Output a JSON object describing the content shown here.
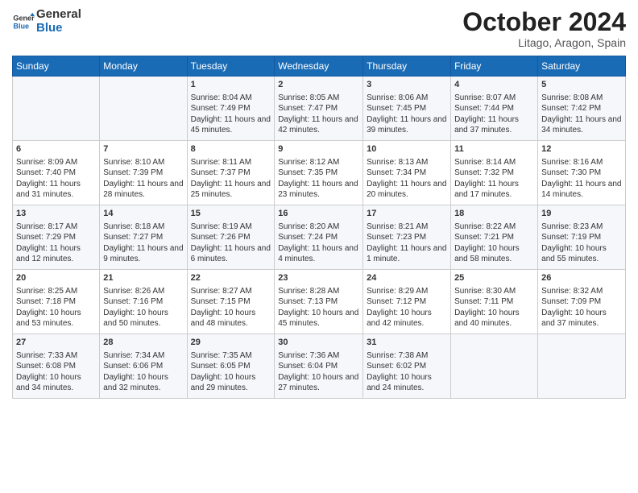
{
  "header": {
    "logo_general": "General",
    "logo_blue": "Blue",
    "month_title": "October 2024",
    "location": "Litago, Aragon, Spain"
  },
  "days_of_week": [
    "Sunday",
    "Monday",
    "Tuesday",
    "Wednesday",
    "Thursday",
    "Friday",
    "Saturday"
  ],
  "weeks": [
    [
      {
        "day": "",
        "info": ""
      },
      {
        "day": "",
        "info": ""
      },
      {
        "day": "1",
        "info": "Sunrise: 8:04 AM\nSunset: 7:49 PM\nDaylight: 11 hours and 45 minutes."
      },
      {
        "day": "2",
        "info": "Sunrise: 8:05 AM\nSunset: 7:47 PM\nDaylight: 11 hours and 42 minutes."
      },
      {
        "day": "3",
        "info": "Sunrise: 8:06 AM\nSunset: 7:45 PM\nDaylight: 11 hours and 39 minutes."
      },
      {
        "day": "4",
        "info": "Sunrise: 8:07 AM\nSunset: 7:44 PM\nDaylight: 11 hours and 37 minutes."
      },
      {
        "day": "5",
        "info": "Sunrise: 8:08 AM\nSunset: 7:42 PM\nDaylight: 11 hours and 34 minutes."
      }
    ],
    [
      {
        "day": "6",
        "info": "Sunrise: 8:09 AM\nSunset: 7:40 PM\nDaylight: 11 hours and 31 minutes."
      },
      {
        "day": "7",
        "info": "Sunrise: 8:10 AM\nSunset: 7:39 PM\nDaylight: 11 hours and 28 minutes."
      },
      {
        "day": "8",
        "info": "Sunrise: 8:11 AM\nSunset: 7:37 PM\nDaylight: 11 hours and 25 minutes."
      },
      {
        "day": "9",
        "info": "Sunrise: 8:12 AM\nSunset: 7:35 PM\nDaylight: 11 hours and 23 minutes."
      },
      {
        "day": "10",
        "info": "Sunrise: 8:13 AM\nSunset: 7:34 PM\nDaylight: 11 hours and 20 minutes."
      },
      {
        "day": "11",
        "info": "Sunrise: 8:14 AM\nSunset: 7:32 PM\nDaylight: 11 hours and 17 minutes."
      },
      {
        "day": "12",
        "info": "Sunrise: 8:16 AM\nSunset: 7:30 PM\nDaylight: 11 hours and 14 minutes."
      }
    ],
    [
      {
        "day": "13",
        "info": "Sunrise: 8:17 AM\nSunset: 7:29 PM\nDaylight: 11 hours and 12 minutes."
      },
      {
        "day": "14",
        "info": "Sunrise: 8:18 AM\nSunset: 7:27 PM\nDaylight: 11 hours and 9 minutes."
      },
      {
        "day": "15",
        "info": "Sunrise: 8:19 AM\nSunset: 7:26 PM\nDaylight: 11 hours and 6 minutes."
      },
      {
        "day": "16",
        "info": "Sunrise: 8:20 AM\nSunset: 7:24 PM\nDaylight: 11 hours and 4 minutes."
      },
      {
        "day": "17",
        "info": "Sunrise: 8:21 AM\nSunset: 7:23 PM\nDaylight: 11 hours and 1 minute."
      },
      {
        "day": "18",
        "info": "Sunrise: 8:22 AM\nSunset: 7:21 PM\nDaylight: 10 hours and 58 minutes."
      },
      {
        "day": "19",
        "info": "Sunrise: 8:23 AM\nSunset: 7:19 PM\nDaylight: 10 hours and 55 minutes."
      }
    ],
    [
      {
        "day": "20",
        "info": "Sunrise: 8:25 AM\nSunset: 7:18 PM\nDaylight: 10 hours and 53 minutes."
      },
      {
        "day": "21",
        "info": "Sunrise: 8:26 AM\nSunset: 7:16 PM\nDaylight: 10 hours and 50 minutes."
      },
      {
        "day": "22",
        "info": "Sunrise: 8:27 AM\nSunset: 7:15 PM\nDaylight: 10 hours and 48 minutes."
      },
      {
        "day": "23",
        "info": "Sunrise: 8:28 AM\nSunset: 7:13 PM\nDaylight: 10 hours and 45 minutes."
      },
      {
        "day": "24",
        "info": "Sunrise: 8:29 AM\nSunset: 7:12 PM\nDaylight: 10 hours and 42 minutes."
      },
      {
        "day": "25",
        "info": "Sunrise: 8:30 AM\nSunset: 7:11 PM\nDaylight: 10 hours and 40 minutes."
      },
      {
        "day": "26",
        "info": "Sunrise: 8:32 AM\nSunset: 7:09 PM\nDaylight: 10 hours and 37 minutes."
      }
    ],
    [
      {
        "day": "27",
        "info": "Sunrise: 7:33 AM\nSunset: 6:08 PM\nDaylight: 10 hours and 34 minutes."
      },
      {
        "day": "28",
        "info": "Sunrise: 7:34 AM\nSunset: 6:06 PM\nDaylight: 10 hours and 32 minutes."
      },
      {
        "day": "29",
        "info": "Sunrise: 7:35 AM\nSunset: 6:05 PM\nDaylight: 10 hours and 29 minutes."
      },
      {
        "day": "30",
        "info": "Sunrise: 7:36 AM\nSunset: 6:04 PM\nDaylight: 10 hours and 27 minutes."
      },
      {
        "day": "31",
        "info": "Sunrise: 7:38 AM\nSunset: 6:02 PM\nDaylight: 10 hours and 24 minutes."
      },
      {
        "day": "",
        "info": ""
      },
      {
        "day": "",
        "info": ""
      }
    ]
  ]
}
